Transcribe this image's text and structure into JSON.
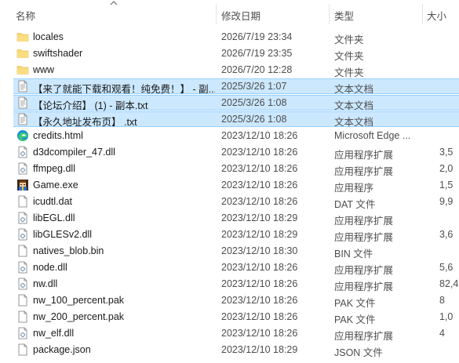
{
  "columns": {
    "name": "名称",
    "date": "修改日期",
    "type": "类型",
    "size": "大小"
  },
  "files": [
    {
      "name": "locales",
      "date": "2026/7/19 23:34",
      "type": "文件夹",
      "size": "",
      "icon": "folder-icon",
      "selected": false
    },
    {
      "name": "swiftshader",
      "date": "2026/7/19 23:35",
      "type": "文件夹",
      "size": "",
      "icon": "folder-icon",
      "selected": false
    },
    {
      "name": "www",
      "date": "2026/7/20 12:28",
      "type": "文件夹",
      "size": "",
      "icon": "folder-icon",
      "selected": false
    },
    {
      "name": "【来了就能下载和观看！纯免费！】 - 副...",
      "date": "2025/3/26 1:07",
      "type": "文本文档",
      "size": "",
      "icon": "text-document-icon",
      "selected": true
    },
    {
      "name": "【论坛介绍】 (1) - 副本.txt",
      "date": "2025/3/26 1:08",
      "type": "文本文档",
      "size": "",
      "icon": "text-document-icon",
      "selected": true
    },
    {
      "name": "【永久地址发布页】 .txt",
      "date": "2025/3/26 1:08",
      "type": "文本文档",
      "size": "",
      "icon": "text-document-icon",
      "selected": true
    },
    {
      "name": "credits.html",
      "date": "2023/12/10 18:26",
      "type": "Microsoft Edge ...",
      "size": "",
      "icon": "edge-icon",
      "selected": false
    },
    {
      "name": "d3dcompiler_47.dll",
      "date": "2023/12/10 18:26",
      "type": "应用程序扩展",
      "size": "3,5",
      "icon": "dll-icon",
      "selected": false
    },
    {
      "name": "ffmpeg.dll",
      "date": "2023/12/10 18:26",
      "type": "应用程序扩展",
      "size": "2,0",
      "icon": "dll-icon",
      "selected": false
    },
    {
      "name": "Game.exe",
      "date": "2023/12/10 18:26",
      "type": "应用程序",
      "size": "1,5",
      "icon": "game-exe-icon",
      "selected": false
    },
    {
      "name": "icudtl.dat",
      "date": "2023/12/10 18:26",
      "type": "DAT 文件",
      "size": "9,9",
      "icon": "blank-file-icon",
      "selected": false
    },
    {
      "name": "libEGL.dll",
      "date": "2023/12/10 18:29",
      "type": "应用程序扩展",
      "size": "",
      "icon": "dll-icon",
      "selected": false
    },
    {
      "name": "libGLESv2.dll",
      "date": "2023/12/10 18:29",
      "type": "应用程序扩展",
      "size": "3,6",
      "icon": "dll-icon",
      "selected": false
    },
    {
      "name": "natives_blob.bin",
      "date": "2023/12/10 18:30",
      "type": "BIN 文件",
      "size": "",
      "icon": "blank-file-icon",
      "selected": false
    },
    {
      "name": "node.dll",
      "date": "2023/12/10 18:26",
      "type": "应用程序扩展",
      "size": "5,6",
      "icon": "dll-icon",
      "selected": false
    },
    {
      "name": "nw.dll",
      "date": "2023/12/10 18:26",
      "type": "应用程序扩展",
      "size": "82,4",
      "icon": "dll-icon",
      "selected": false
    },
    {
      "name": "nw_100_percent.pak",
      "date": "2023/12/10 18:26",
      "type": "PAK 文件",
      "size": "8",
      "icon": "blank-file-icon",
      "selected": false
    },
    {
      "name": "nw_200_percent.pak",
      "date": "2023/12/10 18:26",
      "type": "PAK 文件",
      "size": "1,0",
      "icon": "blank-file-icon",
      "selected": false
    },
    {
      "name": "nw_elf.dll",
      "date": "2023/12/10 18:26",
      "type": "应用程序扩展",
      "size": "4",
      "icon": "dll-icon",
      "selected": false
    },
    {
      "name": "package.json",
      "date": "2023/12/10 18:29",
      "type": "JSON 文件",
      "size": "",
      "icon": "blank-file-icon",
      "selected": false
    }
  ],
  "colors": {
    "selection_fill": "#cce8ff",
    "selection_border": "#99d1ff",
    "folder": "#f8d775",
    "header_text": "#4d4d4d"
  }
}
